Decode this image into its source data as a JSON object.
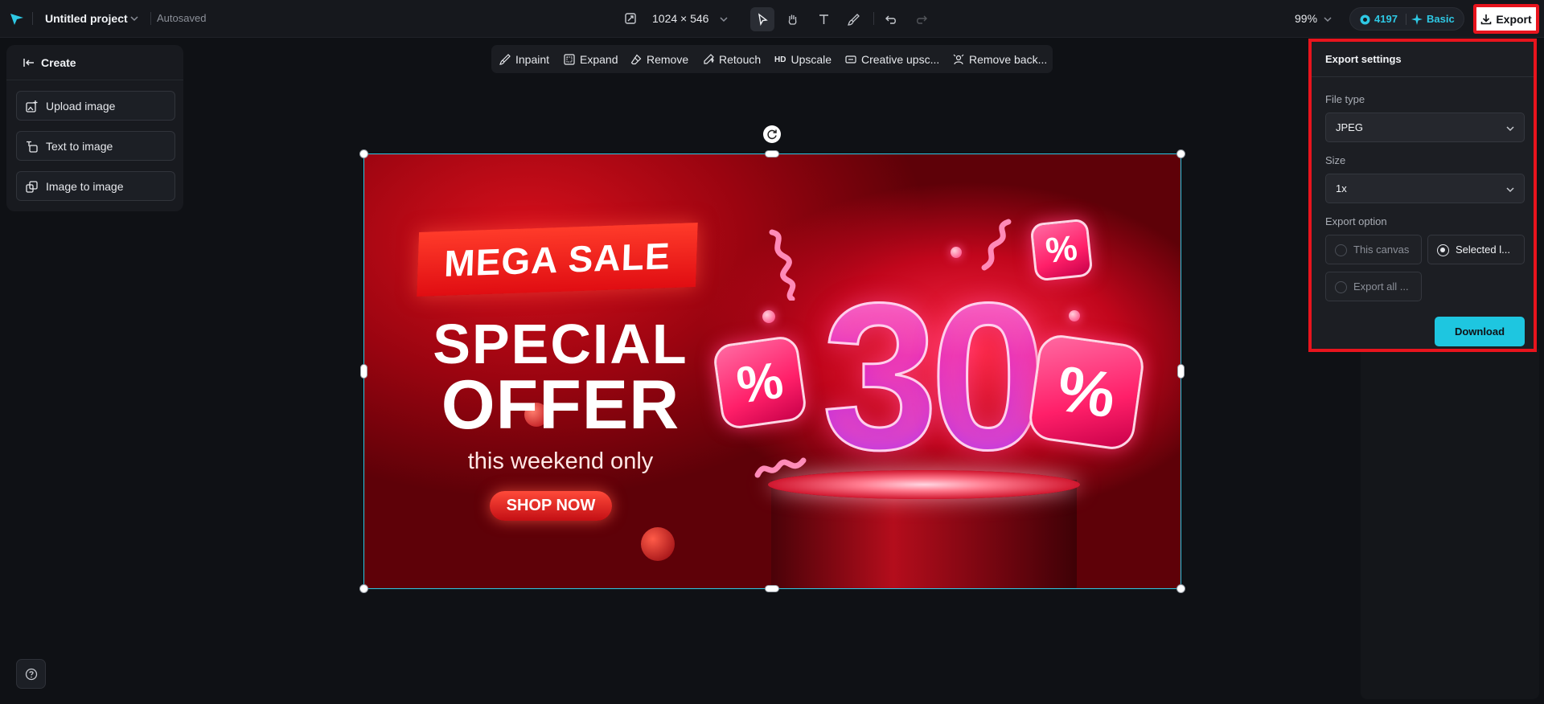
{
  "topbar": {
    "project_name": "Untitled project",
    "autosave_status": "Autosaved",
    "canvas_size": "1024 × 546",
    "zoom": "99%",
    "credits": "4197",
    "plan": "Basic",
    "export_label": "Export"
  },
  "left_panel": {
    "title": "Create",
    "items": [
      {
        "label": "Upload image",
        "icon": "upload-image-icon"
      },
      {
        "label": "Text to image",
        "icon": "text-to-image-icon"
      },
      {
        "label": "Image to image",
        "icon": "image-to-image-icon"
      }
    ]
  },
  "edit_toolbar": {
    "items": [
      {
        "label": "Inpaint",
        "icon": "inpaint-icon"
      },
      {
        "label": "Expand",
        "icon": "expand-icon"
      },
      {
        "label": "Remove",
        "icon": "eraser-icon"
      },
      {
        "label": "Retouch",
        "icon": "retouch-icon"
      },
      {
        "label": "Upscale",
        "icon": "hd-icon",
        "badge": "HD"
      },
      {
        "label": "Creative upsc...",
        "icon": "creative-upscale-icon"
      },
      {
        "label": "Remove back...",
        "icon": "remove-background-icon"
      }
    ]
  },
  "banner": {
    "headline": "MEGA SALE",
    "line1": "SPECIAL",
    "line2": "OFFER",
    "tagline": "this weekend only",
    "cta": "SHOP NOW",
    "discount": "30",
    "percent_symbol": "%"
  },
  "export_panel": {
    "title": "Export settings",
    "file_type_label": "File type",
    "file_type_value": "JPEG",
    "size_label": "Size",
    "size_value": "1x",
    "option_label": "Export option",
    "options": [
      {
        "label": "This canvas",
        "selected": false
      },
      {
        "label": "Selected l...",
        "selected": true
      },
      {
        "label": "Export all ...",
        "selected": false
      }
    ],
    "download_label": "Download"
  },
  "colors": {
    "accent": "#2ec8e4",
    "export_highlight": "#e8141d",
    "download_bg": "#1ec6e0",
    "background": "#0f1115"
  }
}
